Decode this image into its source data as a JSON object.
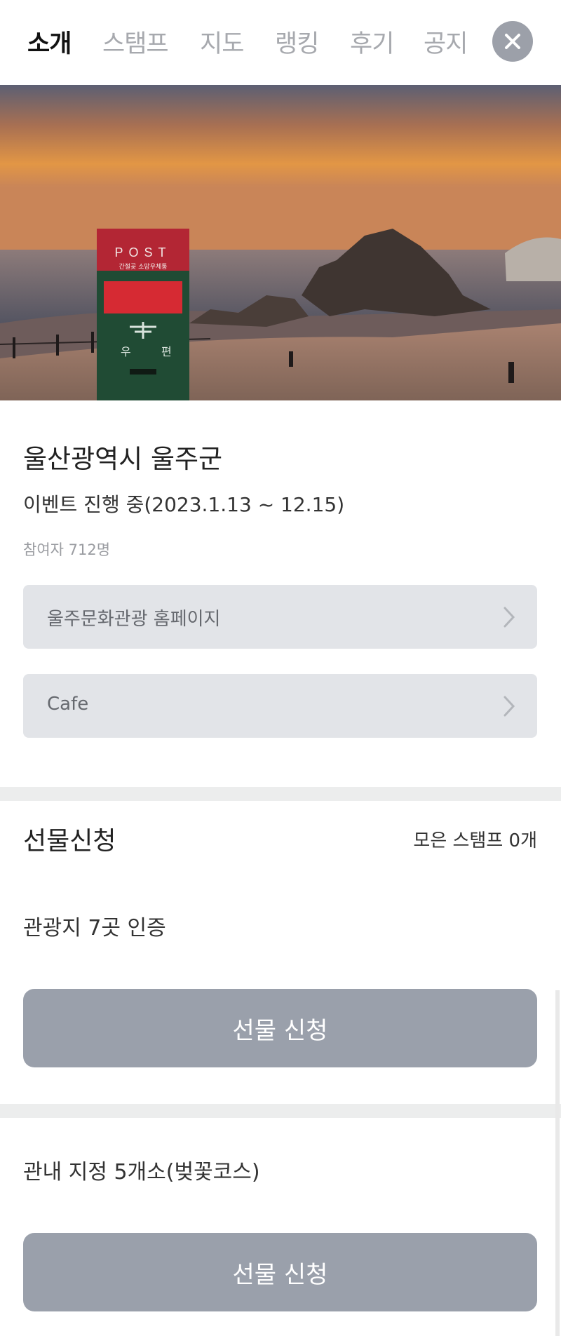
{
  "nav": {
    "tabs": [
      "소개",
      "스탬프",
      "지도",
      "랭킹",
      "후기",
      "공지"
    ],
    "active_tab": "소개"
  },
  "hero": {
    "postbox_text": "POST",
    "postbox_sub": "간절곶 소망우체통",
    "postbox_char1": "우",
    "postbox_char2": "편"
  },
  "info": {
    "title": "울산광역시 울주군",
    "period": "이벤트 진행 중(2023.1.13 ~ 12.15)",
    "participants": "참여자 712명"
  },
  "links": [
    {
      "label": "울주문화관광 홈페이지"
    },
    {
      "label": "Cafe"
    }
  ],
  "gift": {
    "title": "선물신청",
    "stamp_count": "모은 스탬프 0개",
    "sections": [
      {
        "label": "관광지 7곳 인증",
        "button": "선물 신청"
      },
      {
        "label": "관내 지정 5개소(벚꽃코스)",
        "button": "선물 신청"
      }
    ]
  },
  "colors": {
    "active_tab": "#111111",
    "inactive_tab": "#a7a9ae",
    "link_button_bg": "#e2e4e8",
    "gift_button_bg": "#9aa0ab",
    "divider": "#eceded"
  }
}
